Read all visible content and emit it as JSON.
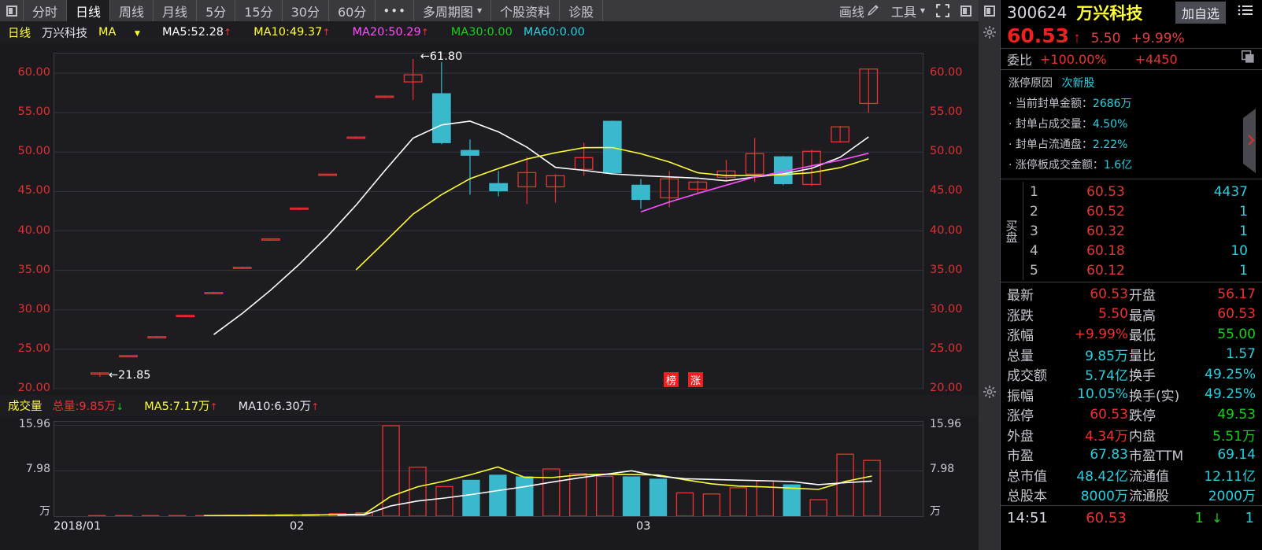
{
  "toolbar": {
    "panel_icon": "panel-toggle-icon",
    "periods": [
      {
        "label": "分时",
        "active": false
      },
      {
        "label": "日线",
        "active": true
      },
      {
        "label": "周线",
        "active": false
      },
      {
        "label": "月线",
        "active": false
      },
      {
        "label": "5分",
        "active": false
      },
      {
        "label": "15分",
        "active": false
      },
      {
        "label": "30分",
        "active": false
      },
      {
        "label": "60分",
        "active": false
      }
    ],
    "more": "•••",
    "multi_period": "多周期图",
    "stock_info": "个股资料",
    "diagnose": "诊股",
    "draw_line": "画线",
    "tools": "工具",
    "fullscreen_icon": "fullscreen-icon",
    "layout_icon": "layout-panel-icon"
  },
  "indicator_bar": {
    "period": "日线",
    "stock_name": "万兴科技",
    "ma_label": "MA",
    "items": [
      {
        "text": "MA5:52.28",
        "color": "#ffffff",
        "arrow": "up"
      },
      {
        "text": "MA10:49.37",
        "color": "#ffff33",
        "arrow": "up"
      },
      {
        "text": "MA20:50.29",
        "color": "#ff50ff",
        "arrow": "up"
      },
      {
        "text": "MA30:0.00",
        "color": "#17d017",
        "arrow": ""
      },
      {
        "text": "MA60:0.00",
        "color": "#25d0e0",
        "arrow": ""
      }
    ],
    "icons": [
      "lock-icon",
      "refresh-icon",
      "zoom-in-icon",
      "zoom-out-icon",
      "gear-icon"
    ]
  },
  "chart_data": {
    "type": "line",
    "title": "万兴科技 300624 日线",
    "xlabel": "",
    "ylabel": "",
    "ylim": [
      20.0,
      62.5
    ],
    "grid": true,
    "y_ticks": [
      "60.00",
      "55.00",
      "50.00",
      "45.00",
      "40.00",
      "35.00",
      "30.00",
      "25.00",
      "20.00"
    ],
    "x_ticks": [
      "2018/01",
      "02",
      "03"
    ],
    "annotations": [
      {
        "text": "61.80",
        "kind": "high-marker"
      },
      {
        "text": "21.85",
        "kind": "low-marker"
      }
    ],
    "badges": [
      "榜",
      "涨"
    ],
    "candles": [
      {
        "o": 21.85,
        "h": 22.0,
        "l": 21.5,
        "c": 22.0,
        "dir": "up"
      },
      {
        "o": 24.1,
        "h": 24.2,
        "l": 24.0,
        "c": 24.2,
        "dir": "up"
      },
      {
        "o": 26.5,
        "h": 26.6,
        "l": 26.4,
        "c": 26.6,
        "dir": "up"
      },
      {
        "o": 29.2,
        "h": 29.3,
        "l": 29.1,
        "c": 29.3,
        "dir": "up"
      },
      {
        "o": 32.1,
        "h": 32.2,
        "l": 32.0,
        "c": 32.2,
        "dir": "up"
      },
      {
        "o": 35.3,
        "h": 35.4,
        "l": 35.2,
        "c": 35.4,
        "dir": "up"
      },
      {
        "o": 38.9,
        "h": 39.0,
        "l": 38.8,
        "c": 39.0,
        "dir": "up"
      },
      {
        "o": 42.8,
        "h": 42.9,
        "l": 42.7,
        "c": 42.9,
        "dir": "up"
      },
      {
        "o": 47.1,
        "h": 47.2,
        "l": 47.0,
        "c": 47.2,
        "dir": "up"
      },
      {
        "o": 51.8,
        "h": 51.9,
        "l": 51.7,
        "c": 51.9,
        "dir": "up"
      },
      {
        "o": 57.0,
        "h": 57.1,
        "l": 56.9,
        "c": 57.1,
        "dir": "up"
      },
      {
        "o": 58.9,
        "h": 61.8,
        "l": 56.6,
        "c": 59.8,
        "dir": "up"
      },
      {
        "o": 57.4,
        "h": 61.4,
        "l": 51.0,
        "c": 51.2,
        "dir": "down"
      },
      {
        "o": 50.2,
        "h": 51.6,
        "l": 44.6,
        "c": 49.6,
        "dir": "down"
      },
      {
        "o": 46.0,
        "h": 47.6,
        "l": 44.4,
        "c": 45.1,
        "dir": "down"
      },
      {
        "o": 45.6,
        "h": 49.4,
        "l": 43.4,
        "c": 47.4,
        "dir": "up"
      },
      {
        "o": 45.6,
        "h": 47.2,
        "l": 43.6,
        "c": 47.0,
        "dir": "up"
      },
      {
        "o": 47.8,
        "h": 51.2,
        "l": 47.0,
        "c": 49.3,
        "dir": "up"
      },
      {
        "o": 53.9,
        "h": 54.0,
        "l": 47.3,
        "c": 47.4,
        "dir": "down"
      },
      {
        "o": 45.8,
        "h": 46.6,
        "l": 42.8,
        "c": 44.0,
        "dir": "down"
      },
      {
        "o": 44.2,
        "h": 47.6,
        "l": 43.0,
        "c": 46.6,
        "dir": "up"
      },
      {
        "o": 45.3,
        "h": 46.4,
        "l": 44.8,
        "c": 46.2,
        "dir": "up"
      },
      {
        "o": 46.8,
        "h": 49.0,
        "l": 46.4,
        "c": 47.6,
        "dir": "up"
      },
      {
        "o": 47.2,
        "h": 51.8,
        "l": 46.2,
        "c": 49.8,
        "dir": "up"
      },
      {
        "o": 49.4,
        "h": 49.5,
        "l": 45.8,
        "c": 46.0,
        "dir": "down"
      },
      {
        "o": 45.9,
        "h": 50.3,
        "l": 45.7,
        "c": 50.1,
        "dir": "up"
      },
      {
        "o": 51.3,
        "h": 53.3,
        "l": 51.2,
        "c": 53.2,
        "dir": "up"
      },
      {
        "o": 56.17,
        "h": 60.53,
        "l": 55.0,
        "c": 60.53,
        "dir": "up"
      }
    ],
    "ma_series": [
      {
        "name": "MA5",
        "color": "#ffffff",
        "value": 52.28
      },
      {
        "name": "MA10",
        "color": "#ffff33",
        "value": 49.37
      },
      {
        "name": "MA20",
        "color": "#ff50ff",
        "value": 50.29
      }
    ]
  },
  "volume_panel": {
    "title": "成交量",
    "items": [
      {
        "text": "总量:9.85万",
        "color": "#f03030",
        "arrow": "down"
      },
      {
        "text": "MA5:7.17万",
        "color": "#ffff33",
        "arrow": "up"
      },
      {
        "text": "MA10:6.30万",
        "color": "#e8e8ee",
        "arrow": "up"
      }
    ],
    "y_ticks": [
      "15.96",
      "7.98",
      "万"
    ],
    "unit": "万",
    "icons": [
      "close-icon",
      "gear-icon"
    ],
    "values": [
      0.1,
      0.1,
      0.1,
      0.1,
      0.1,
      0.15,
      0.2,
      0.25,
      0.3,
      0.45,
      0.6,
      15.9,
      8.6,
      5.2,
      6.3,
      7.2,
      6.9,
      8.3,
      7.5,
      7.0,
      6.9,
      6.5,
      4.1,
      3.9,
      5.0,
      6.2,
      5.5,
      2.9,
      10.9,
      9.8
    ]
  },
  "stock": {
    "code": "300624",
    "name": "万兴科技",
    "add_favorite": "加自选",
    "menu_icon": "list-menu-icon",
    "price": "60.53",
    "change": "5.50",
    "change_pct": "+9.99%",
    "ratio_label": "委比",
    "ratio_value": "+100.00%",
    "ratio_diff": "+4450",
    "copy_icon": "copy-icon"
  },
  "limit_up": {
    "title": "涨停原因",
    "tag": "次新股",
    "rows": [
      {
        "label": "当前封单金额：",
        "value": "2686万"
      },
      {
        "label": "封单占成交量：",
        "value": "4.50%"
      },
      {
        "label": "封单占流通盘：",
        "value": "2.22%"
      },
      {
        "label": "涨停板成交金额：",
        "value": "1.6亿"
      }
    ]
  },
  "order_book": {
    "side_label": "买盘",
    "rows": [
      {
        "n": "1",
        "price": "60.53",
        "vol": "4437"
      },
      {
        "n": "2",
        "price": "60.52",
        "vol": "1"
      },
      {
        "n": "3",
        "price": "60.32",
        "vol": "1"
      },
      {
        "n": "4",
        "price": "60.18",
        "vol": "10"
      },
      {
        "n": "5",
        "price": "60.12",
        "vol": "1"
      }
    ]
  },
  "stats": [
    {
      "l1": "最新",
      "v1": "60.53",
      "c1": "cR",
      "l2": "开盘",
      "v2": "56.17",
      "c2": "cR"
    },
    {
      "l1": "涨跌",
      "v1": "5.50",
      "c1": "cR",
      "l2": "最高",
      "v2": "60.53",
      "c2": "cR"
    },
    {
      "l1": "涨幅",
      "v1": "+9.99%",
      "c1": "cR",
      "l2": "最低",
      "v2": "55.00",
      "c2": "cG"
    },
    {
      "l1": "总量",
      "v1": "9.85万",
      "c1": "cC",
      "l2": "量比",
      "v2": "1.57",
      "c2": "cC"
    },
    {
      "l1": "成交额",
      "v1": "5.74亿",
      "c1": "cC",
      "l2": "换手",
      "v2": "49.25%",
      "c2": "cC"
    },
    {
      "l1": "振幅",
      "v1": "10.05%",
      "c1": "cC",
      "l2": "换手(实)",
      "v2": "49.25%",
      "c2": "cC"
    },
    {
      "l1": "涨停",
      "v1": "60.53",
      "c1": "cR",
      "l2": "跌停",
      "v2": "49.53",
      "c2": "cG"
    },
    {
      "l1": "外盘",
      "v1": "4.34万",
      "c1": "cR",
      "l2": "内盘",
      "v2": "5.51万",
      "c2": "cG"
    },
    {
      "l1": "市盈",
      "v1": "67.83",
      "c1": "cC",
      "l2": "市盈TTM",
      "v2": "69.14",
      "c2": "cC"
    },
    {
      "l1": "总市值",
      "v1": "48.42亿",
      "c1": "cC",
      "l2": "流通值",
      "v2": "12.11亿",
      "c2": "cC"
    },
    {
      "l1": "总股本",
      "v1": "8000万",
      "c1": "cC",
      "l2": "流通股",
      "v2": "2000万",
      "c2": "cC"
    }
  ],
  "last_tick": {
    "time": "14:51",
    "price": "60.53",
    "vol": "1",
    "arrow": "↓",
    "count": "1"
  }
}
